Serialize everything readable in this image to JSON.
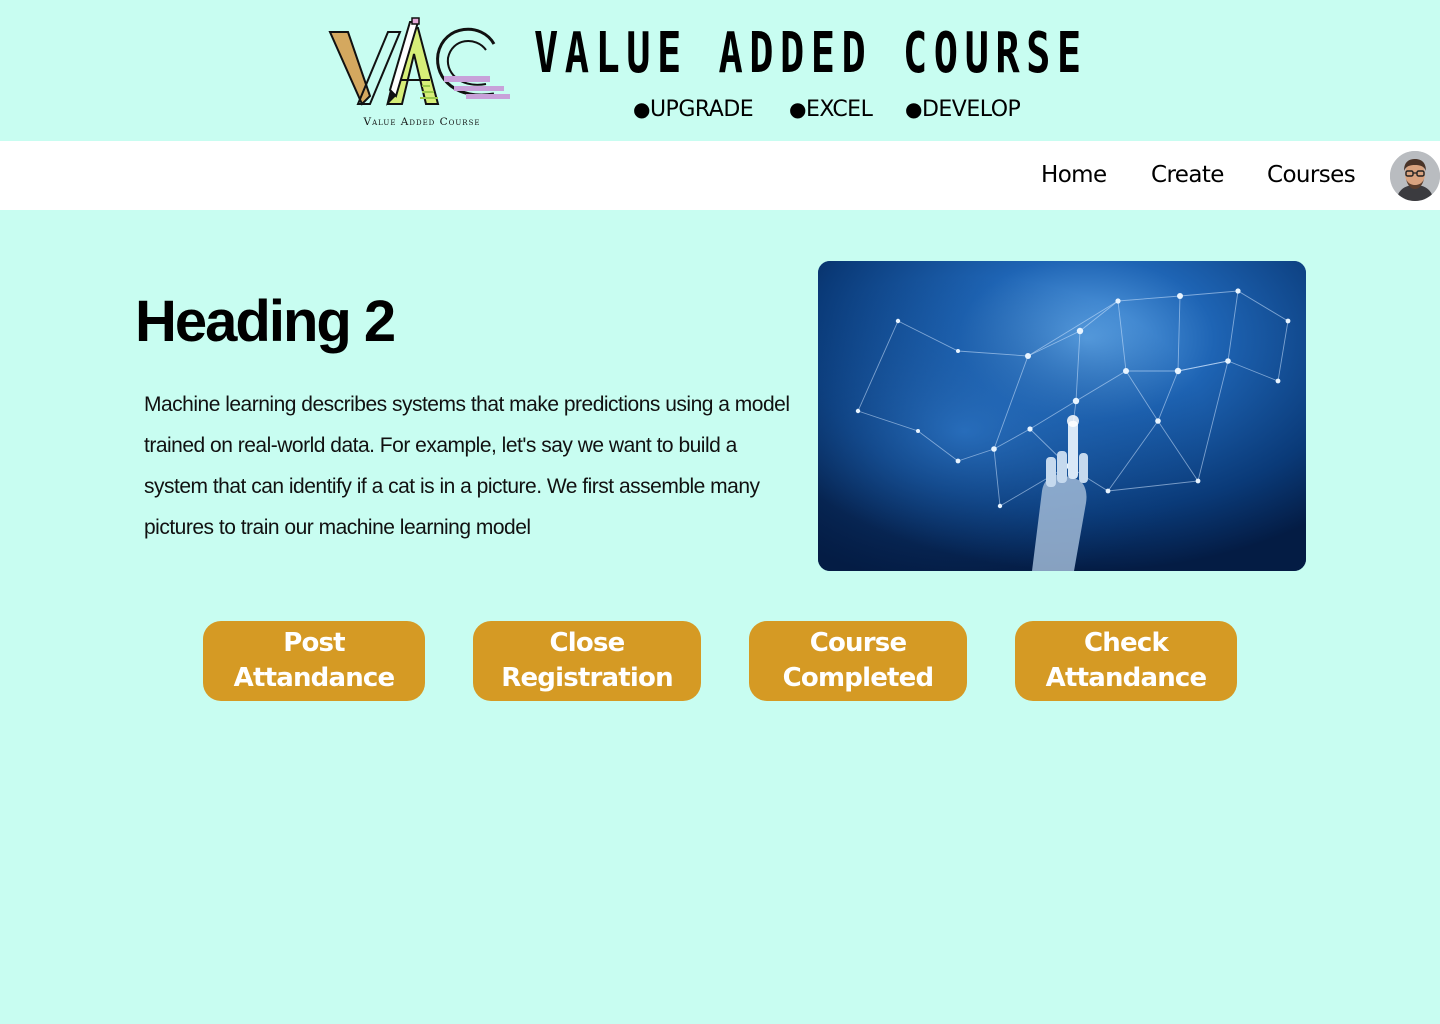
{
  "header": {
    "logo_text": "VAC",
    "logo_caption": "Value Added Course",
    "title": "VALUE ADDED COURSE",
    "taglines": [
      "UPGRADE",
      "EXCEL",
      "DEVELOP"
    ],
    "tagline_bullet": "●"
  },
  "nav": {
    "items": [
      {
        "label": "Home"
      },
      {
        "label": "Create"
      },
      {
        "label": "Courses"
      }
    ],
    "avatar_icon": "user-avatar-icon"
  },
  "main": {
    "heading": "Heading 2",
    "body": "Machine learning describes systems that make predictions using a model trained on real-world data. For example, let's say we want to build a system that can identify if a cat is in a picture. We first assemble many pictures to train our machine learning model",
    "hero_image": "robot-hand-network-image"
  },
  "actions": [
    {
      "line1": "Post",
      "line2": "Attandance"
    },
    {
      "line1": "Close",
      "line2": "Registration"
    },
    {
      "line1": "Course",
      "line2": "Completed"
    },
    {
      "line1": "Check",
      "line2": "Attandance"
    }
  ],
  "colors": {
    "background": "#c8fdf1",
    "nav_background": "#ffffff",
    "button": "#d59a24",
    "button_text": "#ffffff",
    "hero_blue": "#0a3a78"
  }
}
